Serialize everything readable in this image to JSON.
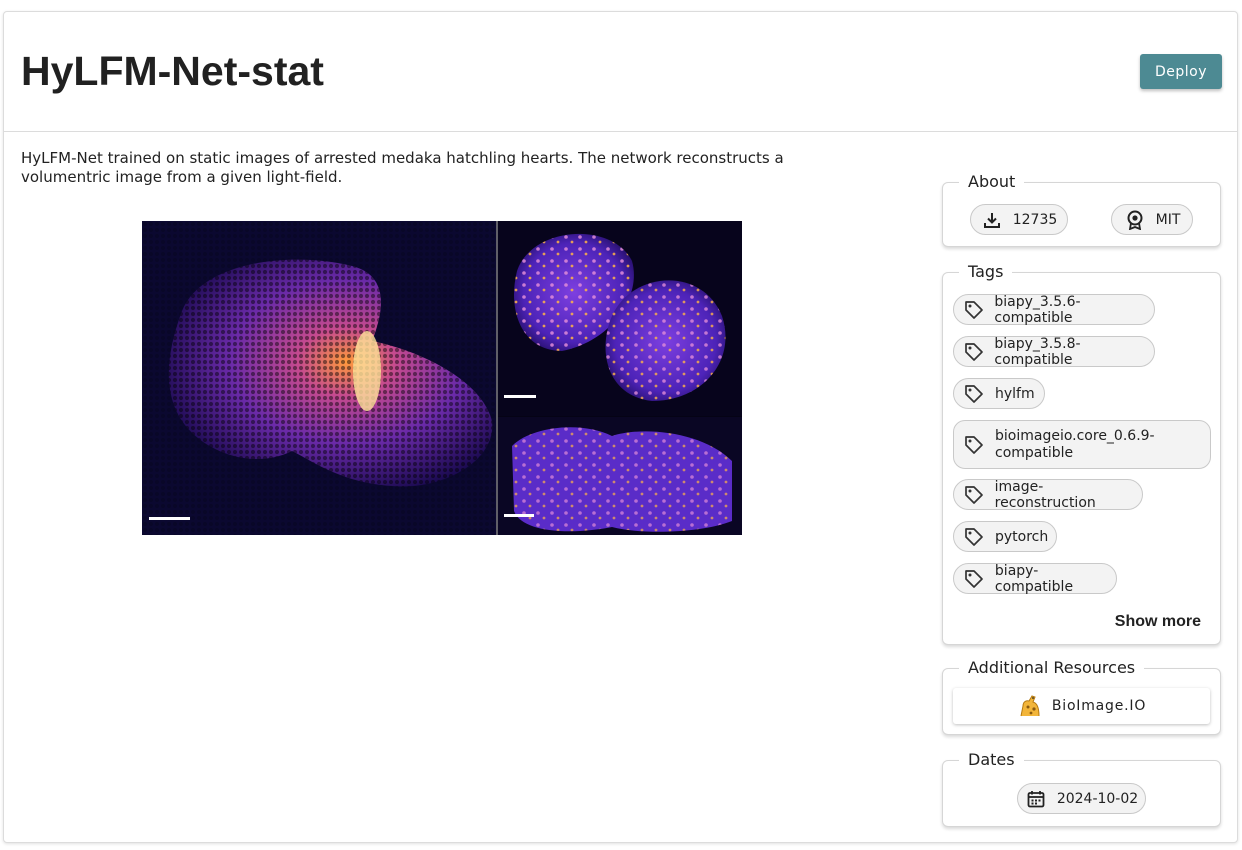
{
  "header": {
    "title": "HyLFM-Net-stat",
    "deploy_label": "Deploy"
  },
  "description": "HyLFM-Net trained on static images of arrested medaka hatchling hearts. The network reconstructs a volumentric image from a given light-field.",
  "about": {
    "legend": "About",
    "downloads": "12735",
    "license": "MIT"
  },
  "tags": {
    "legend": "Tags",
    "items": [
      "biapy_3.5.6-compatible",
      "biapy_3.5.8-compatible",
      "hylfm",
      "bioimageio.core_0.6.9-compatible",
      "image-reconstruction",
      "pytorch",
      "biapy-compatible"
    ],
    "show_more": "Show more"
  },
  "resources": {
    "legend": "Additional Resources",
    "bioimage_label": "BioImage.IO"
  },
  "dates": {
    "legend": "Dates",
    "date": "2024-10-02"
  },
  "colors": {
    "accent": "#4d8a93",
    "chip_bg": "#f3f3f3"
  }
}
